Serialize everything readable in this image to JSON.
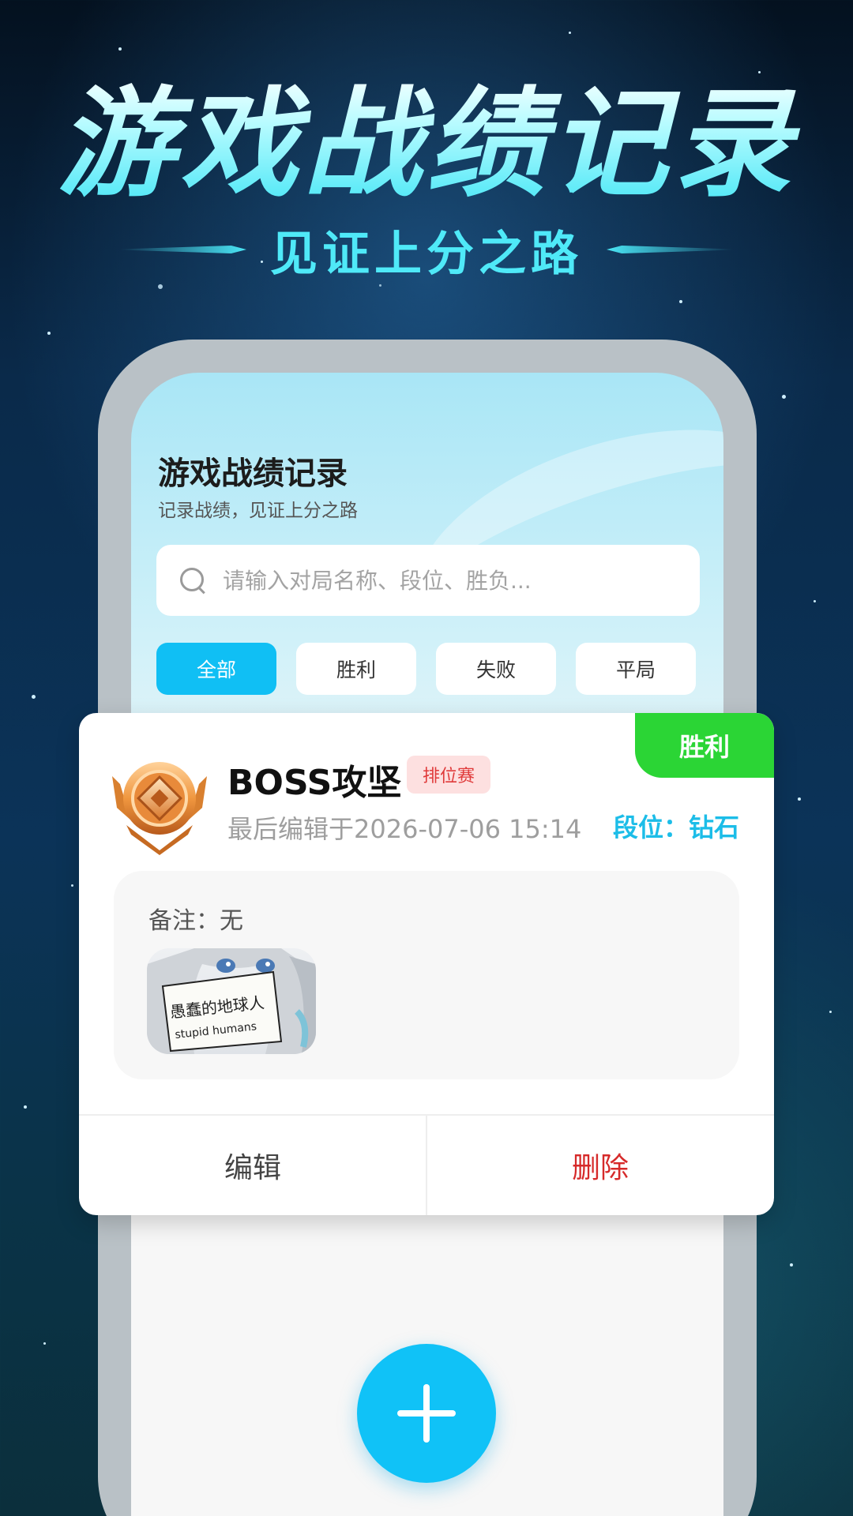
{
  "hero": {
    "title": "游戏战绩记录",
    "subtitle": "见证上分之路"
  },
  "app": {
    "title": "游戏战绩记录",
    "subtitle": "记录战绩，见证上分之路"
  },
  "search": {
    "placeholder": "请输入对局名称、段位、胜负...",
    "value": "",
    "icon": "search-icon"
  },
  "tabs": [
    {
      "label": "全部",
      "active": true
    },
    {
      "label": "胜利",
      "active": false
    },
    {
      "label": "失败",
      "active": false
    },
    {
      "label": "平局",
      "active": false
    }
  ],
  "record": {
    "result": "胜利",
    "name": "BOSS攻坚",
    "mode": "排位赛",
    "edited": "最后编辑于2026-07-06 15:14",
    "rank": "段位：钻石",
    "note": "备注：无",
    "image_caption_cn": "愚蠢的地球人",
    "image_caption_en": "stupid humans",
    "edit_label": "编辑",
    "delete_label": "删除",
    "medal_icon": "rank-medal-icon"
  },
  "fab": {
    "icon": "plus-icon"
  },
  "colors": {
    "accent": "#10bff4",
    "win": "#2bd535",
    "delete": "#d62a2a",
    "rank": "#1cbde8",
    "hero_text": "#4fe9f8"
  }
}
